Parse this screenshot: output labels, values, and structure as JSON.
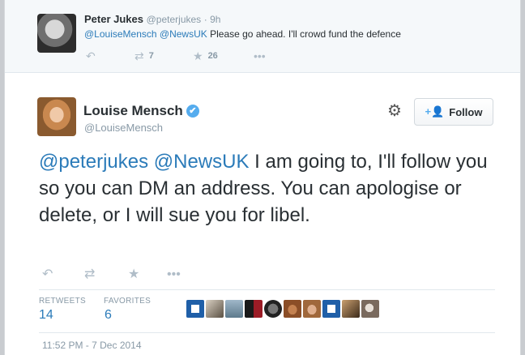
{
  "parent_tweet": {
    "author_name": "Peter Jukes",
    "author_handle": "@peterjukes",
    "time_ago": "· 9h",
    "mentions": [
      "@LouiseMensch",
      "@NewsUK"
    ],
    "text": "Please go ahead. I'll crowd fund the defence",
    "retweet_count": "7",
    "favorite_count": "26",
    "icons": {
      "reply": "reply-icon",
      "retweet": "retweet-icon",
      "favorite": "star-icon",
      "more": "more-icon"
    }
  },
  "tweet": {
    "author_name": "Louise Mensch",
    "author_handle": "@LouiseMensch",
    "verified_glyph": "✔",
    "follow_label": "Follow",
    "follow_glyph": "+👤",
    "mentions": [
      "@peterjukes",
      "@NewsUK"
    ],
    "text": "I am going to, I'll follow you so you can DM an address. You can apologise or delete, or I will sue you for libel.",
    "stats": {
      "retweets_label": "RETWEETS",
      "retweets_value": "14",
      "favorites_label": "FAVORITES",
      "favorites_value": "6"
    },
    "timestamp": "11:52 PM - 7 Dec 2014",
    "favoriter_count": 10
  },
  "colors": {
    "link": "#2b7bb9",
    "verified": "#55acee",
    "muted": "#8899a6",
    "parent_bg": "#f5f8fa"
  }
}
